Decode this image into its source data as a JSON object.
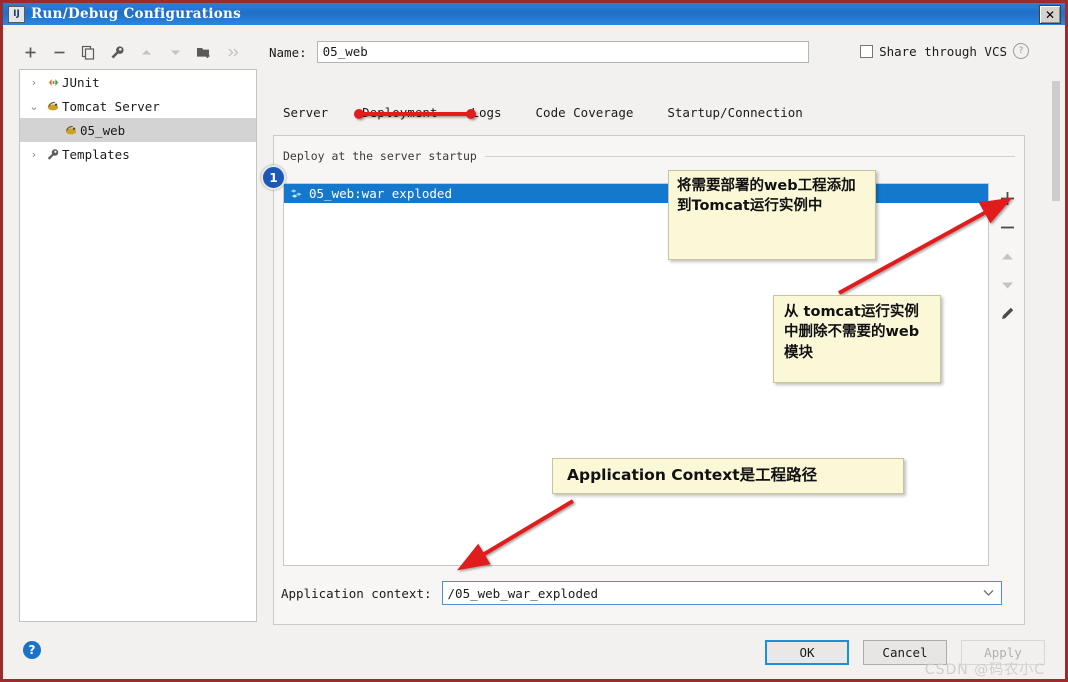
{
  "window": {
    "title": "Run/Debug Configurations",
    "icon": "intellij-idea-icon",
    "close_label": "✕"
  },
  "left_toolbar": {
    "icons": [
      {
        "name": "add-icon",
        "glyph": "＋",
        "dim": false
      },
      {
        "name": "remove-icon",
        "glyph": "−",
        "dim": false
      },
      {
        "name": "copy-icon",
        "glyph": "❐",
        "dim": false
      },
      {
        "name": "wrench-icon",
        "glyph": "🔧",
        "dim": false
      },
      {
        "name": "move-up-icon",
        "glyph": "▲",
        "dim": true
      },
      {
        "name": "move-down-icon",
        "glyph": "▼",
        "dim": true
      },
      {
        "name": "new-folder-icon",
        "glyph": "🗁",
        "dim": false
      },
      {
        "name": "more-icon",
        "glyph": "»",
        "dim": true
      }
    ]
  },
  "tree": {
    "items": [
      {
        "label": "JUnit",
        "twisty": "›",
        "icon": "junit-icon",
        "indent": 0,
        "selected": false
      },
      {
        "label": "Tomcat Server",
        "twisty": "⌄",
        "icon": "tomcat-icon",
        "indent": 0,
        "selected": false
      },
      {
        "label": "05_web",
        "twisty": "",
        "icon": "tomcat-icon",
        "indent": 1,
        "selected": true
      },
      {
        "label": "Templates",
        "twisty": "›",
        "icon": "wrench-icon",
        "indent": 0,
        "selected": false
      }
    ]
  },
  "name_field": {
    "label": "Name:",
    "value": "05_web",
    "placeholder": ""
  },
  "share_vcs": {
    "label": "Share through VCS",
    "checked": false,
    "help": "?"
  },
  "tabs": [
    {
      "label": "Server",
      "active": false
    },
    {
      "label": "Deployment",
      "active": true
    },
    {
      "label": "Logs",
      "active": false
    },
    {
      "label": "Code Coverage",
      "active": false
    },
    {
      "label": "Startup/Connection",
      "active": false
    }
  ],
  "deployment_panel": {
    "legend": "Deploy at the server startup",
    "items": [
      {
        "label": "05_web:war exploded",
        "icon": "artifact-icon",
        "selected": true
      }
    ],
    "side_buttons": [
      {
        "name": "add-artifact-button",
        "glyph": "＋",
        "dim": false
      },
      {
        "name": "remove-artifact-button",
        "glyph": "−",
        "dim": false
      },
      {
        "name": "move-up-button",
        "glyph": "▲",
        "dim": true
      },
      {
        "name": "move-down-button",
        "glyph": "▼",
        "dim": true
      },
      {
        "name": "edit-artifact-button",
        "glyph": "✎",
        "dim": false
      }
    ]
  },
  "application_context": {
    "label": "Application context:",
    "value": "/05_web_war_exploded",
    "dropdown_arrow": "⌄"
  },
  "footer": {
    "help": "?",
    "buttons": [
      {
        "label": "OK",
        "state": "default"
      },
      {
        "label": "Cancel",
        "state": "normal"
      },
      {
        "label": "Apply",
        "state": "disabled"
      }
    ]
  },
  "watermark": "CSDN @码农小C",
  "annotations": {
    "badge_1": "1",
    "callout_1": "将需要部署的web工程添加到Tomcat运行实例中",
    "callout_2": "从 tomcat运行实例中删除不需要的web模块",
    "callout_3": "Application Context是工程路径"
  },
  "colors": {
    "titlebar": "#2176cd",
    "selection": "#1478cd",
    "annotation_red": "#e01b1b",
    "callout_bg": "#fbf8d8",
    "dialog_border": "#9c2b2b"
  }
}
